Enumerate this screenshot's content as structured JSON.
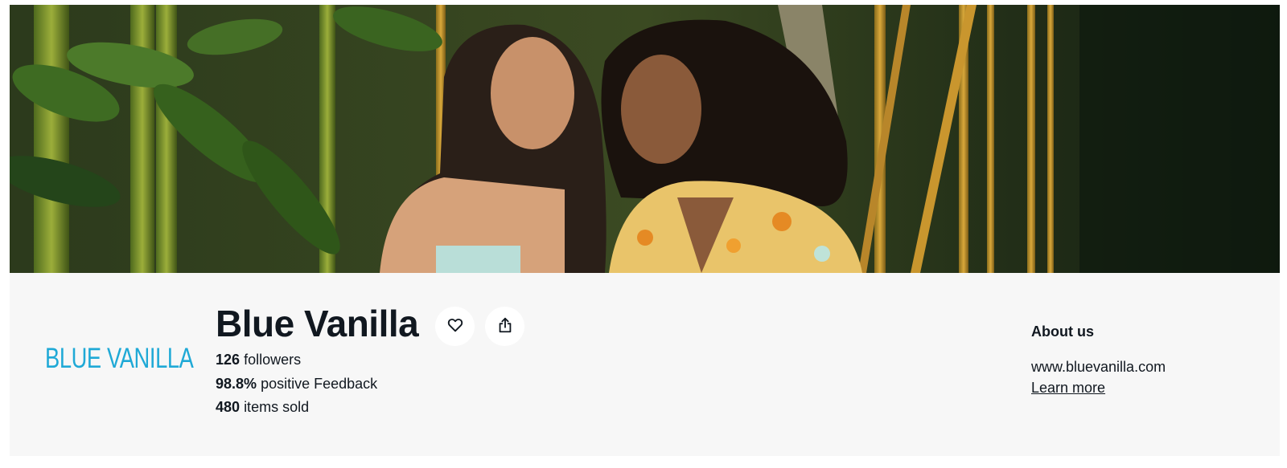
{
  "store": {
    "logo_text": "BLUE VANILLA",
    "name": "Blue Vanilla",
    "follow_icon": "heart-icon",
    "share_icon": "share-icon"
  },
  "stats": {
    "followers_value": "126",
    "followers_label": "followers",
    "feedback_value": "98.8%",
    "feedback_label": "positive Feedback",
    "sold_value": "480",
    "sold_label": "items sold"
  },
  "about": {
    "title": "About us",
    "website": "www.bluevanilla.com",
    "learn_more": "Learn more"
  },
  "colors": {
    "logo": "#1fa9d6",
    "panel_bg": "#f7f7f7",
    "text": "#111820"
  }
}
